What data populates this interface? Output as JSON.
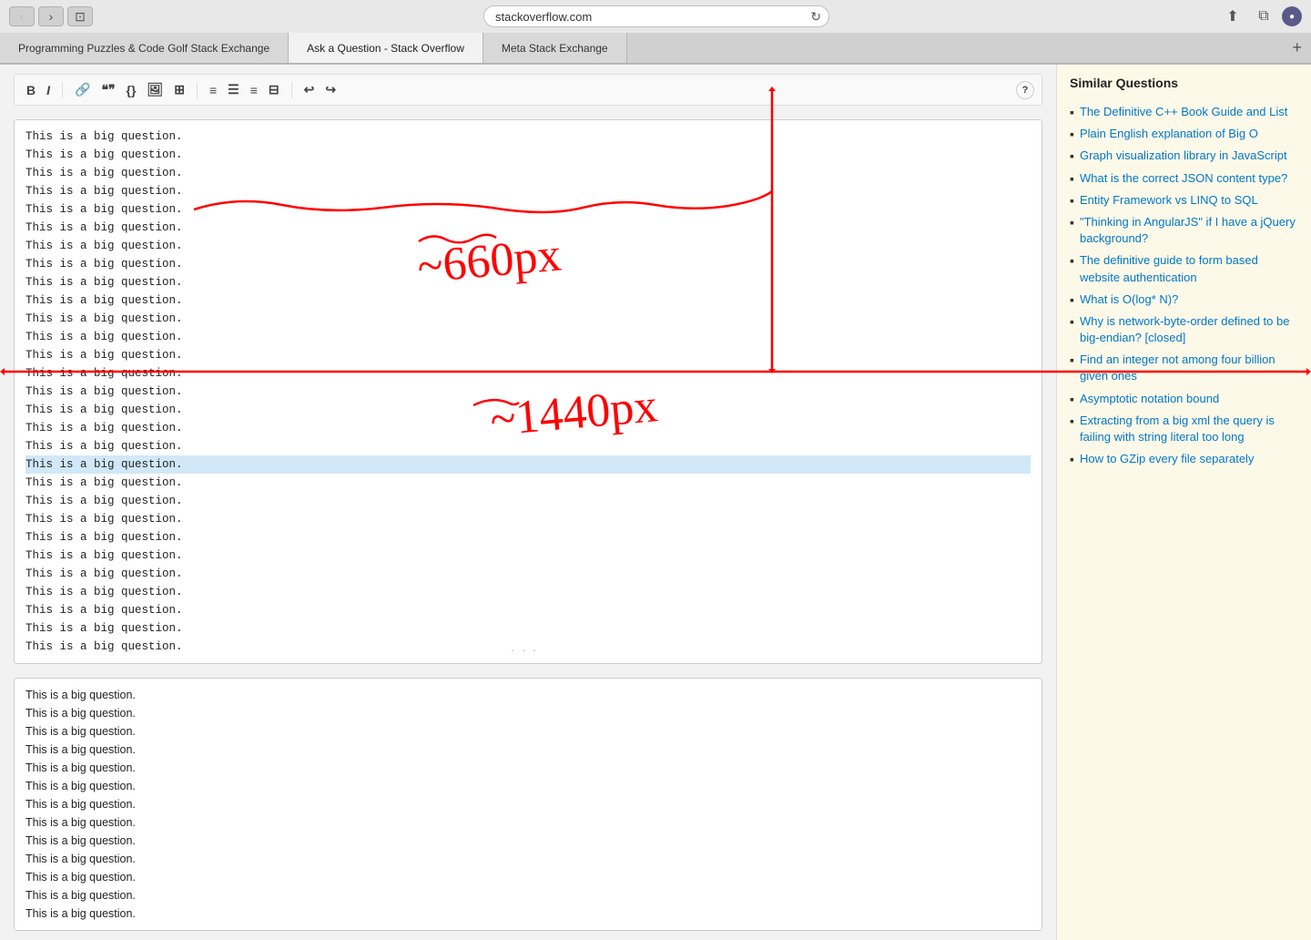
{
  "browser": {
    "url": "stackoverflow.com",
    "tabs": [
      {
        "id": "tab1",
        "label": "Programming Puzzles & Code Golf Stack Exchange",
        "active": false
      },
      {
        "id": "tab2",
        "label": "Ask a Question - Stack Overflow",
        "active": true
      },
      {
        "id": "tab3",
        "label": "Meta Stack Exchange",
        "active": false
      }
    ],
    "add_tab_label": "+",
    "nav": {
      "back_label": "‹",
      "forward_label": "›",
      "view_label": "⊡"
    },
    "actions": {
      "share": "⬆",
      "duplicate": "⧉",
      "profile": "●"
    }
  },
  "editor": {
    "toolbar": {
      "bold": "B",
      "italic": "I",
      "link": "🔗",
      "blockquote": "❝❞",
      "code": "{}",
      "image": "🖼",
      "more": "⊞",
      "ol": "≡",
      "ul": "☰",
      "align": "≡",
      "indent": "⊟",
      "undo": "↩",
      "redo": "↪",
      "help": "?"
    },
    "content_lines": [
      "This is a big question.",
      "This is a big question.",
      "This is a big question.",
      "This is a big question.",
      "This is a big question.",
      "This is a big question.",
      "This is a big question.",
      "This is a big question.",
      "This is a big question.",
      "This is a big question.",
      "This is a big question.",
      "This is a big question.",
      "This is a big question.",
      "This is a big question.",
      "This is a big question.",
      "This is a big question.",
      "This is a big question.",
      "This is a big question.",
      "This is a big question. (highlighted)",
      "This is a big question.",
      "This is a big question.",
      "This is a big question.",
      "This is a big question.",
      "This is a big question.",
      "This is a big question.",
      "This is a big question.",
      "This is a big question.",
      "This is a big question.",
      "This is a big question."
    ],
    "preview_lines": [
      "This is a big question.",
      "This is a big question.",
      "This is a big question.",
      "This is a big question.",
      "This is a big question.",
      "This is a big question.",
      "This is a big question.",
      "This is a big question.",
      "This is a big question.",
      "This is a big question.",
      "This is a big question.",
      "This is a big question.",
      "This is a big question."
    ]
  },
  "sidebar": {
    "title": "Similar Questions",
    "items": [
      {
        "label": "The Definitive C++ Book Guide and List",
        "href": "#"
      },
      {
        "label": "Plain English explanation of Big O",
        "href": "#"
      },
      {
        "label": "Graph visualization library in JavaScript",
        "href": "#"
      },
      {
        "label": "What is the correct JSON content type?",
        "href": "#"
      },
      {
        "label": "Entity Framework vs LINQ to SQL",
        "href": "#"
      },
      {
        "label": "\"Thinking in AngularJS\" if I have a jQuery background?",
        "href": "#"
      },
      {
        "label": "The definitive guide to form based website authentication",
        "href": "#"
      },
      {
        "label": "What is O(log* N)?",
        "href": "#"
      },
      {
        "label": "Why is network-byte-order defined to be big-endian? [closed]",
        "href": "#"
      },
      {
        "label": "Find an integer not among four billion given ones",
        "href": "#"
      },
      {
        "label": "Asymptotic notation bound",
        "href": "#"
      },
      {
        "label": "Extracting from a big xml the query is failing with string literal too long",
        "href": "#"
      },
      {
        "label": "How to GZip every file separately",
        "href": "#"
      }
    ]
  }
}
